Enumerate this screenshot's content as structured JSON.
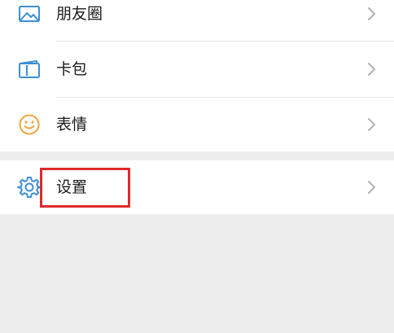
{
  "menu": {
    "items": [
      {
        "label": "朋友圈",
        "icon": "moments-image-icon"
      },
      {
        "label": "卡包",
        "icon": "card-wallet-icon"
      },
      {
        "label": "表情",
        "icon": "smiley-face-icon"
      }
    ],
    "settings": {
      "label": "设置",
      "icon": "gear-icon"
    }
  },
  "colors": {
    "icon_blue": "#3d8fd6",
    "icon_orange": "#f0a640",
    "highlight_red": "#e0292b",
    "chevron_gray": "#b2b2b2",
    "background": "#ededed"
  }
}
